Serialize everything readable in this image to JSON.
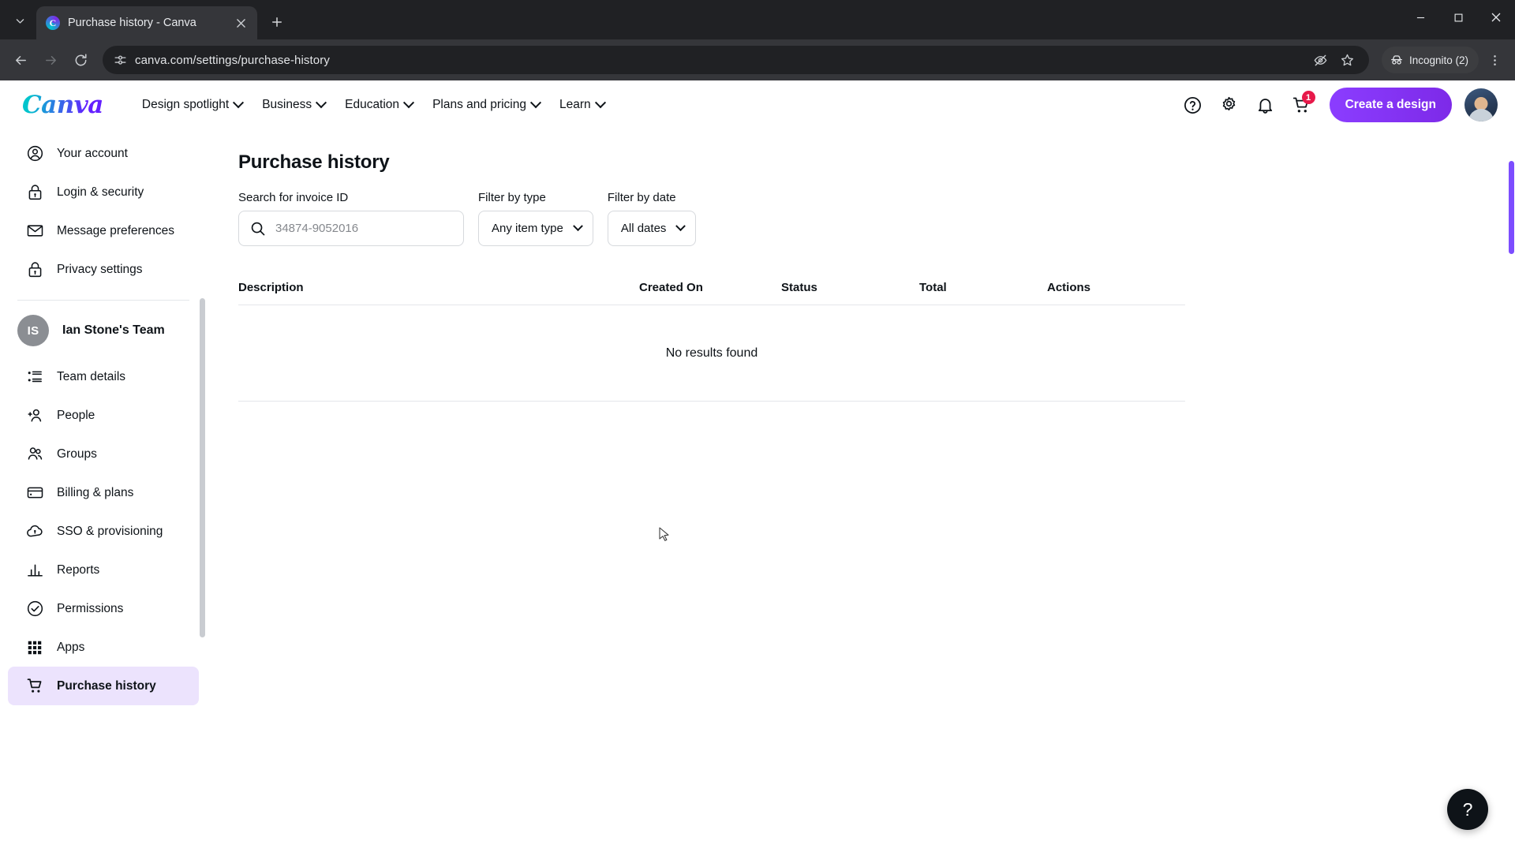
{
  "browser": {
    "tab": {
      "title": "Purchase history - Canva",
      "favicon_letter": "C",
      "close_icon": "close-icon"
    },
    "new_tab_label": "+",
    "tab_search_icon": "chevron-down-icon",
    "back_icon": "back-arrow-icon",
    "forward_icon": "forward-arrow-icon",
    "reload_icon": "reload-icon",
    "site_info_icon": "site-settings-icon",
    "url": "canva.com/settings/purchase-history",
    "tracking_icon": "eye-slash-icon",
    "bookmark_icon": "star-icon",
    "incognito_label": "Incognito (2)",
    "incognito_icon": "incognito-hat-icon",
    "menu_icon": "three-dot-menu-icon",
    "window": {
      "minimize": "minimize-icon",
      "maximize": "maximize-icon",
      "close": "close-icon"
    }
  },
  "canva_header": {
    "logo": "Canva",
    "nav": [
      {
        "label": "Design spotlight",
        "has_chevron": true
      },
      {
        "label": "Business",
        "has_chevron": true
      },
      {
        "label": "Education",
        "has_chevron": true
      },
      {
        "label": "Plans and pricing",
        "has_chevron": true
      },
      {
        "label": "Learn",
        "has_chevron": true
      }
    ],
    "icons": [
      {
        "name": "help-icon",
        "glyph": "?"
      },
      {
        "name": "settings-gear-icon",
        "glyph": "gear"
      },
      {
        "name": "notifications-bell-icon",
        "glyph": "bell"
      },
      {
        "name": "shopping-cart-icon",
        "glyph": "cart",
        "badge": "1"
      }
    ],
    "cta_label": "Create a design",
    "cta_color": "#8b3dff",
    "avatar_name": "user-avatar"
  },
  "sidebar": {
    "account_items": [
      {
        "label": "Your account",
        "icon": "person-circle-icon"
      },
      {
        "label": "Login & security",
        "icon": "lock-icon"
      },
      {
        "label": "Message preferences",
        "icon": "envelope-icon"
      },
      {
        "label": "Privacy settings",
        "icon": "lock-icon"
      }
    ],
    "team": {
      "initials": "IS",
      "name": "Ian Stone's Team"
    },
    "team_items": [
      {
        "label": "Team details",
        "icon": "list-icon",
        "active": false
      },
      {
        "label": "People",
        "icon": "add-person-icon",
        "active": false
      },
      {
        "label": "Groups",
        "icon": "group-people-icon",
        "active": false
      },
      {
        "label": "Billing & plans",
        "icon": "credit-card-icon",
        "active": false
      },
      {
        "label": "SSO & provisioning",
        "icon": "cloud-lock-icon",
        "active": false
      },
      {
        "label": "Reports",
        "icon": "bar-chart-icon",
        "active": false
      },
      {
        "label": "Permissions",
        "icon": "check-circle-icon",
        "active": false
      },
      {
        "label": "Apps",
        "icon": "grid-apps-icon",
        "active": false
      },
      {
        "label": "Purchase history",
        "icon": "shopping-cart-icon",
        "active": true
      }
    ],
    "active_bg": "#ece3fd"
  },
  "main": {
    "title": "Purchase history",
    "search": {
      "label": "Search for invoice ID",
      "placeholder": "34874-9052016",
      "value": "",
      "icon": "search-icon"
    },
    "filter_type": {
      "label": "Filter by type",
      "value": "Any item type"
    },
    "filter_date": {
      "label": "Filter by date",
      "value": "All dates"
    },
    "table": {
      "columns": [
        "Description",
        "Created On",
        "Status",
        "Total",
        "Actions"
      ],
      "rows": [],
      "empty_message": "No results found"
    },
    "help_fab": {
      "label": "?",
      "icon": "help-icon"
    }
  }
}
